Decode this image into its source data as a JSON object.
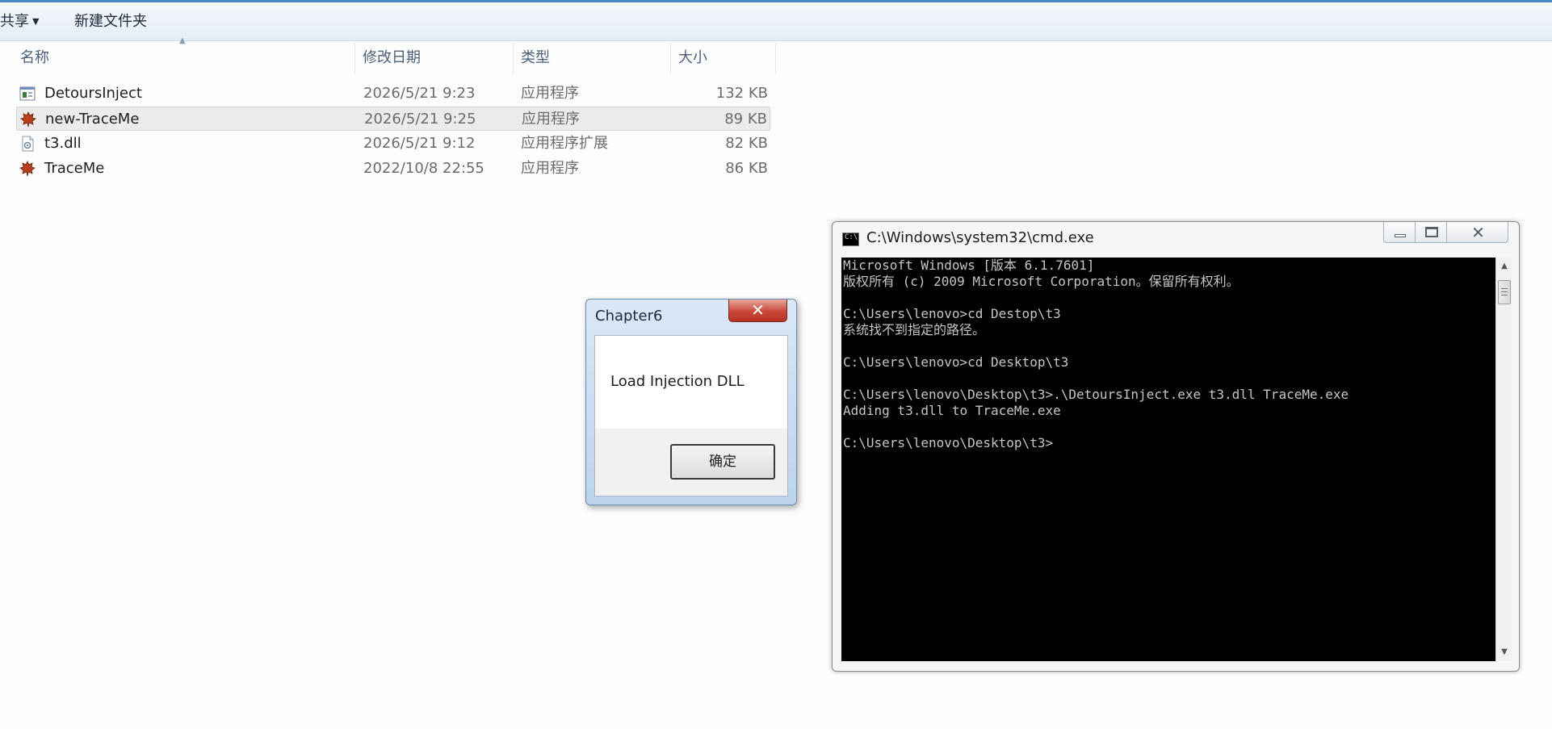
{
  "explorer": {
    "toolbar": {
      "share": "共享",
      "new_folder": "新建文件夹"
    },
    "columns": {
      "name": "名称",
      "date": "修改日期",
      "type": "类型",
      "size": "大小"
    },
    "files": [
      {
        "name": "DetoursInject",
        "date": "2026/5/21 9:23",
        "type": "应用程序",
        "size": "132 KB",
        "icon": "exe-window-icon"
      },
      {
        "name": "new-TraceMe",
        "date": "2026/5/21 9:25",
        "type": "应用程序",
        "size": "89 KB",
        "icon": "maple-leaf-icon"
      },
      {
        "name": "t3.dll",
        "date": "2026/5/21 9:12",
        "type": "应用程序扩展",
        "size": "82 KB",
        "icon": "dll-gear-icon"
      },
      {
        "name": "TraceMe",
        "date": "2022/10/8 22:55",
        "type": "应用程序",
        "size": "86 KB",
        "icon": "maple-leaf-icon"
      }
    ]
  },
  "msgbox": {
    "title": "Chapter6",
    "message": "Load Injection DLL",
    "ok_label": "确定",
    "close_glyph": "✕"
  },
  "cmd": {
    "title": "C:\\Windows\\system32\\cmd.exe",
    "lines": [
      "Microsoft Windows [版本 6.1.7601]",
      "版权所有 (c) 2009 Microsoft Corporation。保留所有权利。",
      "",
      "C:\\Users\\lenovo>cd Destop\\t3",
      "系统找不到指定的路径。",
      "",
      "C:\\Users\\lenovo>cd Desktop\\t3",
      "",
      "C:\\Users\\lenovo\\Desktop\\t3>.\\DetoursInject.exe t3.dll TraceMe.exe",
      "Adding t3.dll to TraceMe.exe",
      "",
      "C:\\Users\\lenovo\\Desktop\\t3>"
    ]
  }
}
